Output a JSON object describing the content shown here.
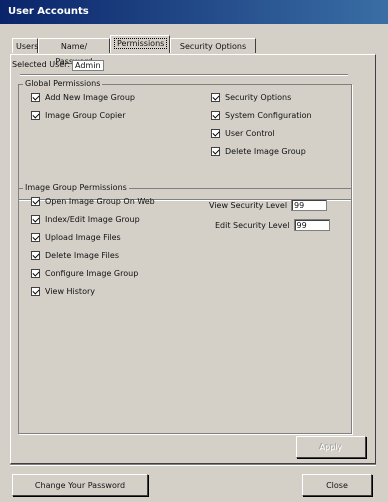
{
  "window": {
    "title": "User Accounts"
  },
  "tabs": [
    {
      "label": "Users"
    },
    {
      "label": "Name/ Password"
    },
    {
      "label": "Permissions"
    },
    {
      "label": "Security Options"
    }
  ],
  "selected_user": {
    "label": "Selected User:",
    "value": "Admin"
  },
  "global_permissions": {
    "title": "Global Permissions",
    "items_left": [
      {
        "label": "Add New Image Group",
        "checked": true
      },
      {
        "label": "Image Group Copier",
        "checked": true
      }
    ],
    "items_right": [
      {
        "label": "Security Options",
        "checked": true
      },
      {
        "label": "System Configuration",
        "checked": true
      },
      {
        "label": "User Control",
        "checked": true
      },
      {
        "label": "Delete Image Group",
        "checked": true
      }
    ]
  },
  "image_group_permissions": {
    "title": "Image Group Permissions",
    "items": [
      {
        "label": "Open Image Group On Web",
        "checked": true
      },
      {
        "label": "Index/Edit Image Group",
        "checked": true
      },
      {
        "label": "Upload Image Files",
        "checked": true
      },
      {
        "label": "Delete Image Files",
        "checked": true
      },
      {
        "label": "Configure Image Group",
        "checked": true
      },
      {
        "label": "View History",
        "checked": true
      }
    ],
    "view_security_level": {
      "label": "View Security Level",
      "value": "99"
    },
    "edit_security_level": {
      "label": "Edit Security Level",
      "value": "99"
    }
  },
  "buttons": {
    "apply": "Apply",
    "change_password": "Change Your Password",
    "close": "Close"
  }
}
